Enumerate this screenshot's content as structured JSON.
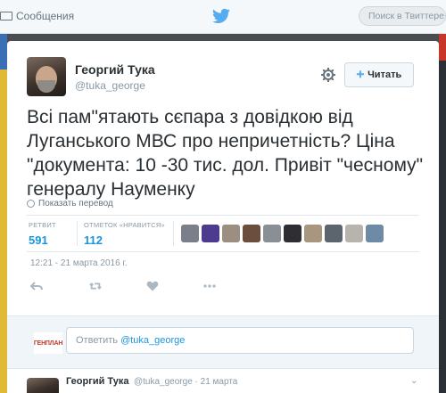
{
  "nav": {
    "messages_label": "Сообщения",
    "search_placeholder": "Поиск в Твиттере"
  },
  "tweet": {
    "author_name": "Георгий Тука",
    "author_handle": "@tuka_george",
    "follow_label": "Читать",
    "text": "Всі пам\"ятають сєпара з довідкою від Луганського МВС про непричетність? Ціна \"документа: 10 -30 тис. дол. Привіт \"чесному\" генералу Науменку",
    "translate_label": "Показать перевод",
    "retweets_label": "РЕТВИТ",
    "retweets_count": "591",
    "likes_label": "ОТМЕТОК «НРАВИТСЯ»",
    "likes_count": "112",
    "timestamp": "12:21 - 21 марта 2016 г."
  },
  "likers": [
    {
      "icon": "liker-avatar",
      "color": "#7a7f8a"
    },
    {
      "icon": "liker-avatar",
      "color": "#4d3b8f"
    },
    {
      "icon": "liker-avatar",
      "color": "#9a8f80"
    },
    {
      "icon": "liker-avatar",
      "color": "#6b4e3d"
    },
    {
      "icon": "liker-avatar",
      "color": "#8a8f95"
    },
    {
      "icon": "liker-avatar",
      "color": "#2f2f33"
    },
    {
      "icon": "liker-avatar",
      "color": "#a8977e"
    },
    {
      "icon": "liker-avatar",
      "color": "#5c646e"
    },
    {
      "icon": "liker-avatar",
      "color": "#b7b3ad"
    },
    {
      "icon": "liker-avatar",
      "color": "#6f8aa6"
    }
  ],
  "reply": {
    "avatar_text": "ГЕНПЛАН",
    "placeholder_prefix": "Ответить ",
    "placeholder_mention": "@tuka_george"
  },
  "next_tweet": {
    "author_name": "Георгий Тука",
    "meta": "@tuka_george · 21 марта"
  },
  "colors": {
    "accent": "#1b95e0",
    "follow_icon": "#55acee"
  }
}
